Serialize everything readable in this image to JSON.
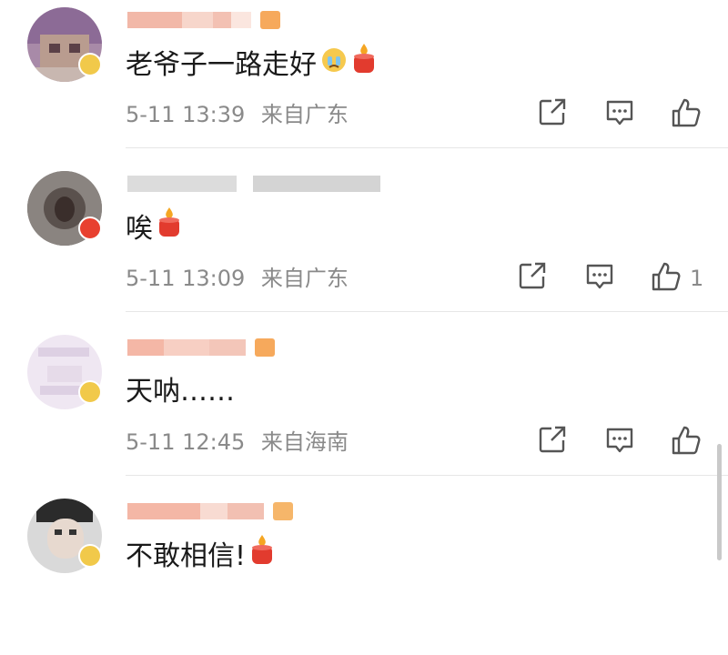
{
  "colors": {
    "text": "#1a1a1a",
    "meta": "#8a8a8a",
    "divider": "#e6e6e6",
    "candle": "#e23b2e",
    "flame": "#f5a623"
  },
  "comments": [
    {
      "text": "老爷子一路走好",
      "emojis": [
        "crying-face-emoji",
        "candle-emoji"
      ],
      "date": "5-11 13:39",
      "location": "来自广东",
      "like_count": ""
    },
    {
      "text": "唉",
      "emojis": [
        "candle-emoji"
      ],
      "date": "5-11 13:09",
      "location": "来自广东",
      "like_count": "1"
    },
    {
      "text": "天呐……",
      "emojis": [],
      "date": "5-11 12:45",
      "location": "来自海南",
      "like_count": ""
    },
    {
      "text": "不敢相信!",
      "emojis": [
        "candle-emoji"
      ],
      "date": "",
      "location": "",
      "like_count": ""
    }
  ],
  "icons": {
    "share": "share-icon",
    "comment": "comment-icon",
    "like": "thumbs-up-icon"
  }
}
